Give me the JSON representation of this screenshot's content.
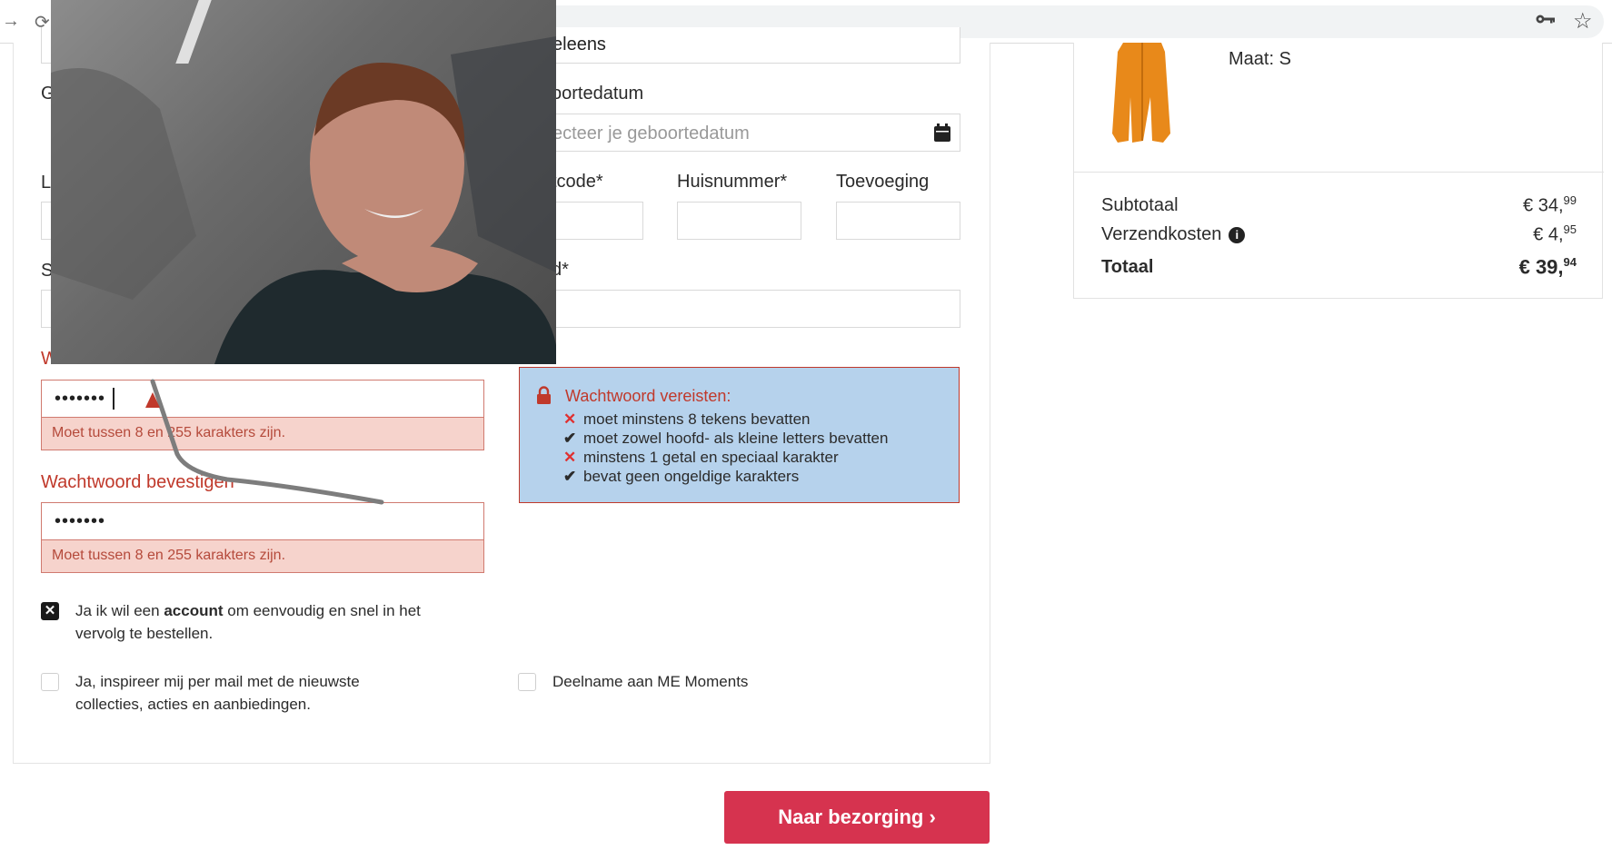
{
  "browser": {
    "back_icon": "→",
    "reload_icon": "⟳",
    "key_icon": "key-icon",
    "star_icon": "☆"
  },
  "form": {
    "top_field_fragment": "eleens",
    "left_label_fragments": [
      "G",
      "L",
      "S"
    ],
    "birthdate_label": "oortedatum",
    "birthdate_placeholder": "ecteer je geboortedatum",
    "postcode_label": "tcode*",
    "huisnummer_label": "Huisnummer*",
    "toevoeging_label": "Toevoeging",
    "plaats_label_fragment": "d*",
    "password_label": "Wachtwoord",
    "password_value": "•••••••",
    "password_error": "Moet tussen 8 en 255 karakters zijn.",
    "confirm_label": "Wachtwoord bevestigen",
    "confirm_value": "•••••••",
    "confirm_error": "Moet tussen 8 en 255 karakters zijn."
  },
  "requirements": {
    "title": "Wachtwoord vereisten:",
    "items": [
      {
        "mark": "✕",
        "text": "moet minstens 8 tekens bevatten"
      },
      {
        "mark": "✔",
        "text": "moet zowel hoofd- als kleine letters bevatten"
      },
      {
        "mark": "✕",
        "text": "minstens 1 getal en speciaal karakter"
      },
      {
        "mark": "✔",
        "text": "bevat geen ongeldige karakters"
      }
    ]
  },
  "checkboxes": {
    "account_before": "Ja ik wil een ",
    "account_bold": "account",
    "account_after_line1": " om eenvoudig en snel in het",
    "account_line2": "vervolg te bestellen.",
    "newsletter_line1": "Ja, inspireer mij per mail met de nieuwste",
    "newsletter_line2": "collecties, acties en aanbiedingen.",
    "moments": "Deelname aan ME Moments"
  },
  "button": {
    "label": "Naar bezorging ›"
  },
  "summary": {
    "size": "Maat: S",
    "subtotal_label": "Subtotaal",
    "subtotal_euros": "€ 34,",
    "subtotal_cents": "99",
    "shipping_label": "Verzendkosten",
    "shipping_euros": "€ 4,",
    "shipping_cents": "95",
    "total_label": "Totaal",
    "total_euros": "€ 39,",
    "total_cents": "94"
  },
  "colors": {
    "accent": "#d6334f",
    "error": "#c0392b",
    "info_bg": "#b6d2ec"
  }
}
